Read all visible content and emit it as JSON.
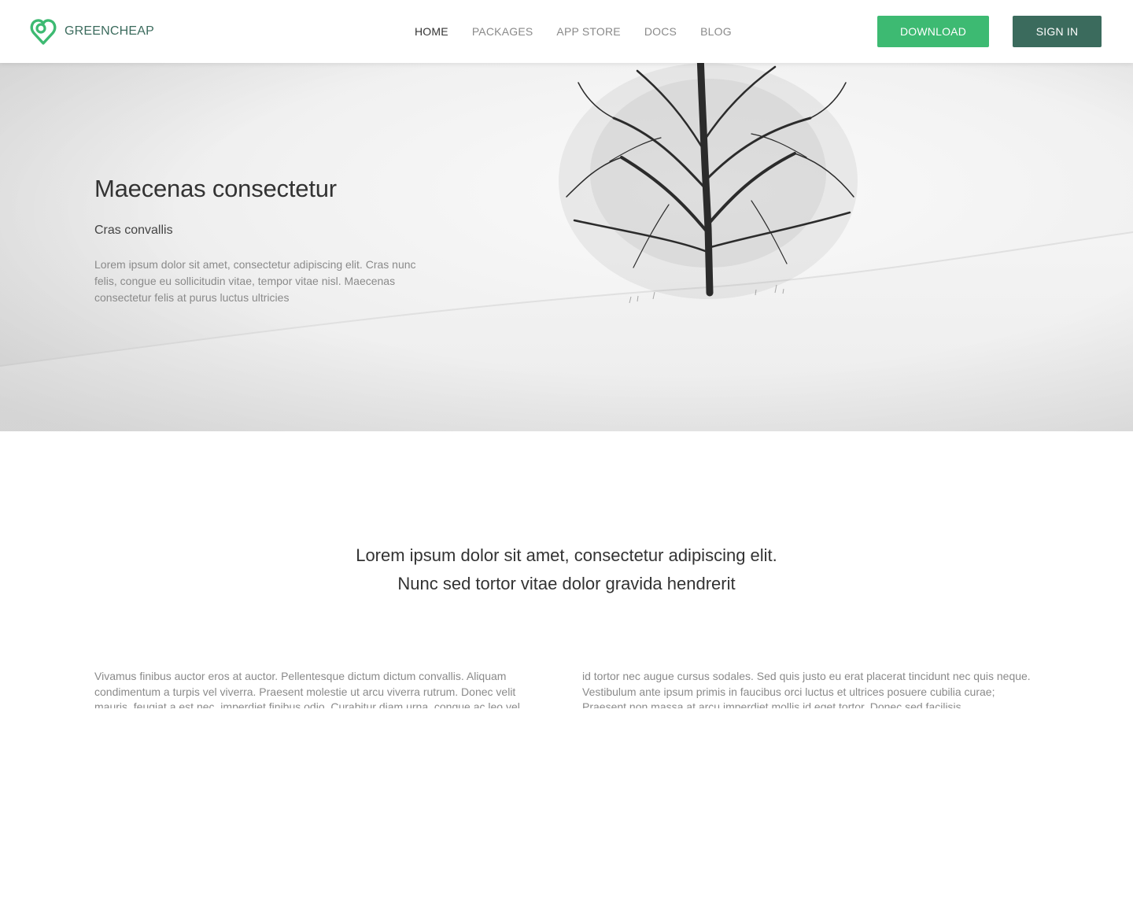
{
  "brand": {
    "name": "GREENCHEAP",
    "logo_icon": "heart-location-icon",
    "primary_color": "#3dba72",
    "dark_color": "#3b6b5d"
  },
  "nav": {
    "items": [
      {
        "label": "HOME",
        "active": true
      },
      {
        "label": "PACKAGES",
        "active": false
      },
      {
        "label": "APP STORE",
        "active": false
      },
      {
        "label": "DOCS",
        "active": false
      },
      {
        "label": "BLOG",
        "active": false
      }
    ]
  },
  "actions": {
    "download_label": "DOWNLOAD",
    "signin_label": "SIGN IN"
  },
  "hero": {
    "title": "Maecenas consectetur",
    "subtitle": "Cras convallis",
    "text": "Lorem ipsum dolor sit amet, consectetur adipiscing elit. Cras nunc felis, congue eu sollicitudin vitae, tempor vitae nisl. Maecenas consectetur felis at purus luctus ultricies"
  },
  "intro": {
    "line1": "Lorem ipsum dolor sit amet, consectetur adipiscing elit.",
    "line2": "Nunc sed tortor vitae dolor gravida hendrerit"
  },
  "columns": {
    "left": "Vivamus finibus auctor eros at auctor. Pellentesque dictum dictum convallis. Aliquam condimentum a turpis vel viverra. Praesent molestie ut arcu viverra rutrum. Donec velit mauris, feugiat a est nec, imperdiet finibus odio. Curabitur diam urna, congue ac leo vel",
    "right": "id tortor nec augue cursus sodales. Sed quis justo eu erat placerat tincidunt nec quis neque. Vestibulum ante ipsum primis in faucibus orci luctus et ultrices posuere cubilia curae; Praesent non massa at arcu imperdiet mollis id eget tortor. Donec sed facilisis"
  }
}
